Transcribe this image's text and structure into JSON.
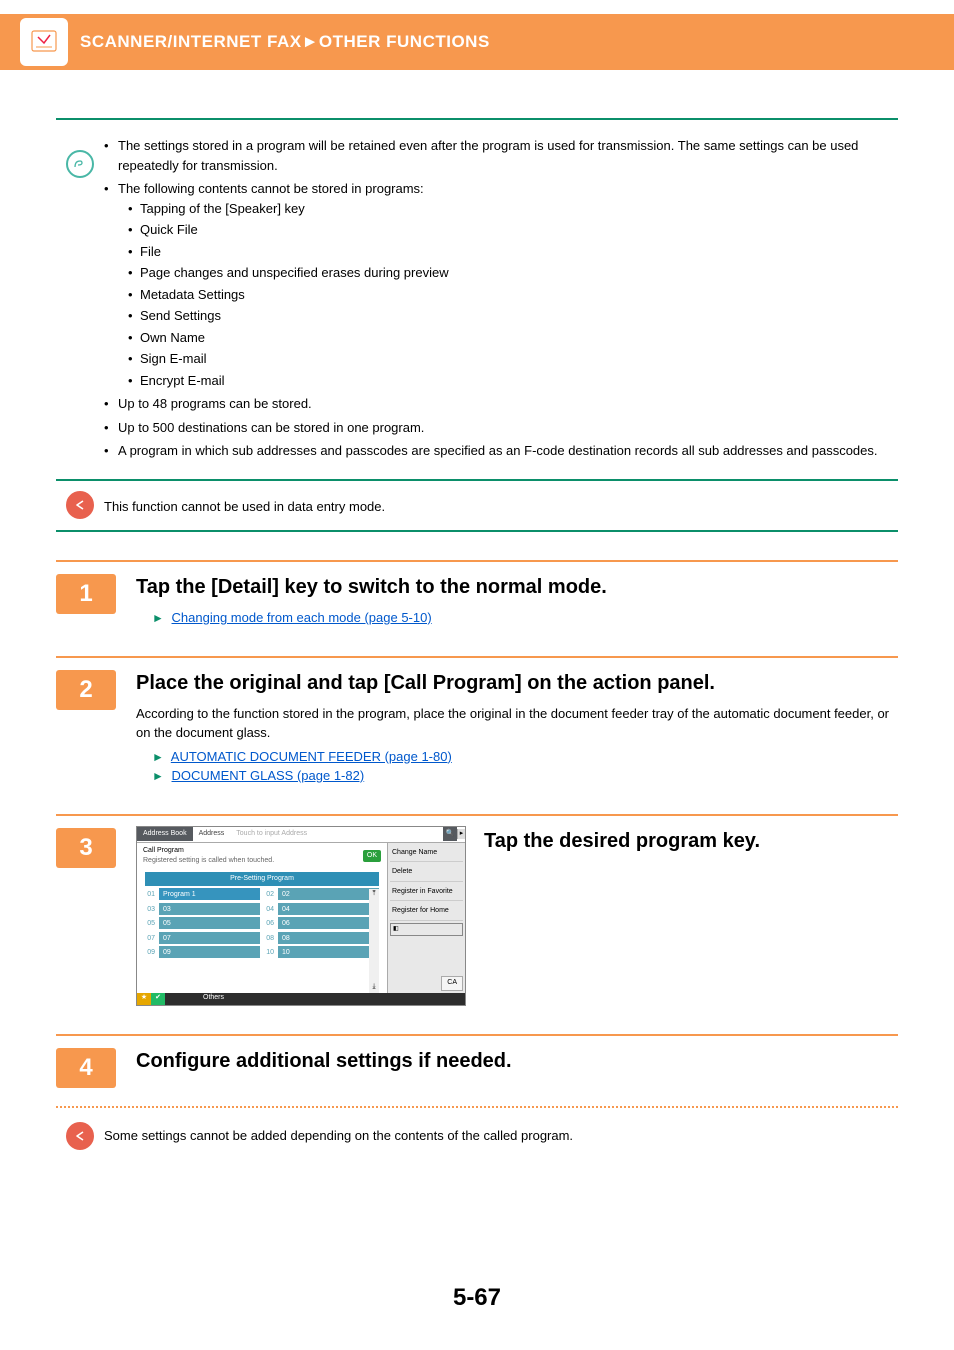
{
  "header": {
    "left": "SCANNER/INTERNET FAX",
    "sep": "►",
    "right": "OTHER FUNCTIONS"
  },
  "info": {
    "bullets": [
      "The settings stored in a program will be retained even after the program is used for transmission. The same settings can be used repeatedly for transmission.",
      "The following contents cannot be stored in programs:"
    ],
    "sub_bullets": [
      "Tapping of the [Speaker] key",
      "Quick File",
      "File",
      "Page changes and unspecified erases during preview",
      "Metadata Settings",
      "Send Settings",
      "Own Name",
      "Sign E-mail",
      "Encrypt E-mail"
    ],
    "bullets_after": [
      "Up to 48 programs can be stored.",
      "Up to 500 destinations can be stored in one program.",
      "A program in which sub addresses and passcodes are specified as an F-code destination records all sub addresses and passcodes."
    ]
  },
  "restrict": {
    "text": "This function cannot be used in data entry mode."
  },
  "steps": {
    "s1": {
      "num": "1",
      "title": "Tap the [Detail] key to switch to the normal mode.",
      "link": "Changing mode from each mode (page 5-10)"
    },
    "s2": {
      "num": "2",
      "title": "Place the original and tap [Call Program] on the action panel.",
      "desc": "According to the function stored in the program, place the original in the document feeder tray of the automatic document feeder, or on the document glass.",
      "link1": "AUTOMATIC DOCUMENT FEEDER (page 1-80)",
      "link2": "DOCUMENT GLASS (page 1-82)"
    },
    "s3": {
      "num": "3",
      "title": "Tap the desired program key.",
      "mockup": {
        "tab_addr_book": "Address Book",
        "tab_address": "Address",
        "touch_input": "Touch to input Address",
        "call_program": "Call Program",
        "registered": "Registered setting is called when touched.",
        "presetting": "Pre-Setting Program",
        "ok": "OK",
        "right_items": [
          "Change Name",
          "Delete",
          "Register in Favorite",
          "Register for Home"
        ],
        "ca": "CA",
        "others": "Others",
        "program1": "Program 1",
        "nums": [
          "01",
          "02",
          "03",
          "04",
          "05",
          "06",
          "07",
          "08",
          "09",
          "10"
        ],
        "cells": [
          "02",
          "03",
          "04",
          "05",
          "06",
          "07",
          "08",
          "09",
          "10"
        ]
      }
    },
    "s4": {
      "num": "4",
      "title": "Configure additional settings if needed.",
      "warn": "Some settings cannot be added depending on the contents of the called program."
    }
  },
  "page_number": "5-67"
}
